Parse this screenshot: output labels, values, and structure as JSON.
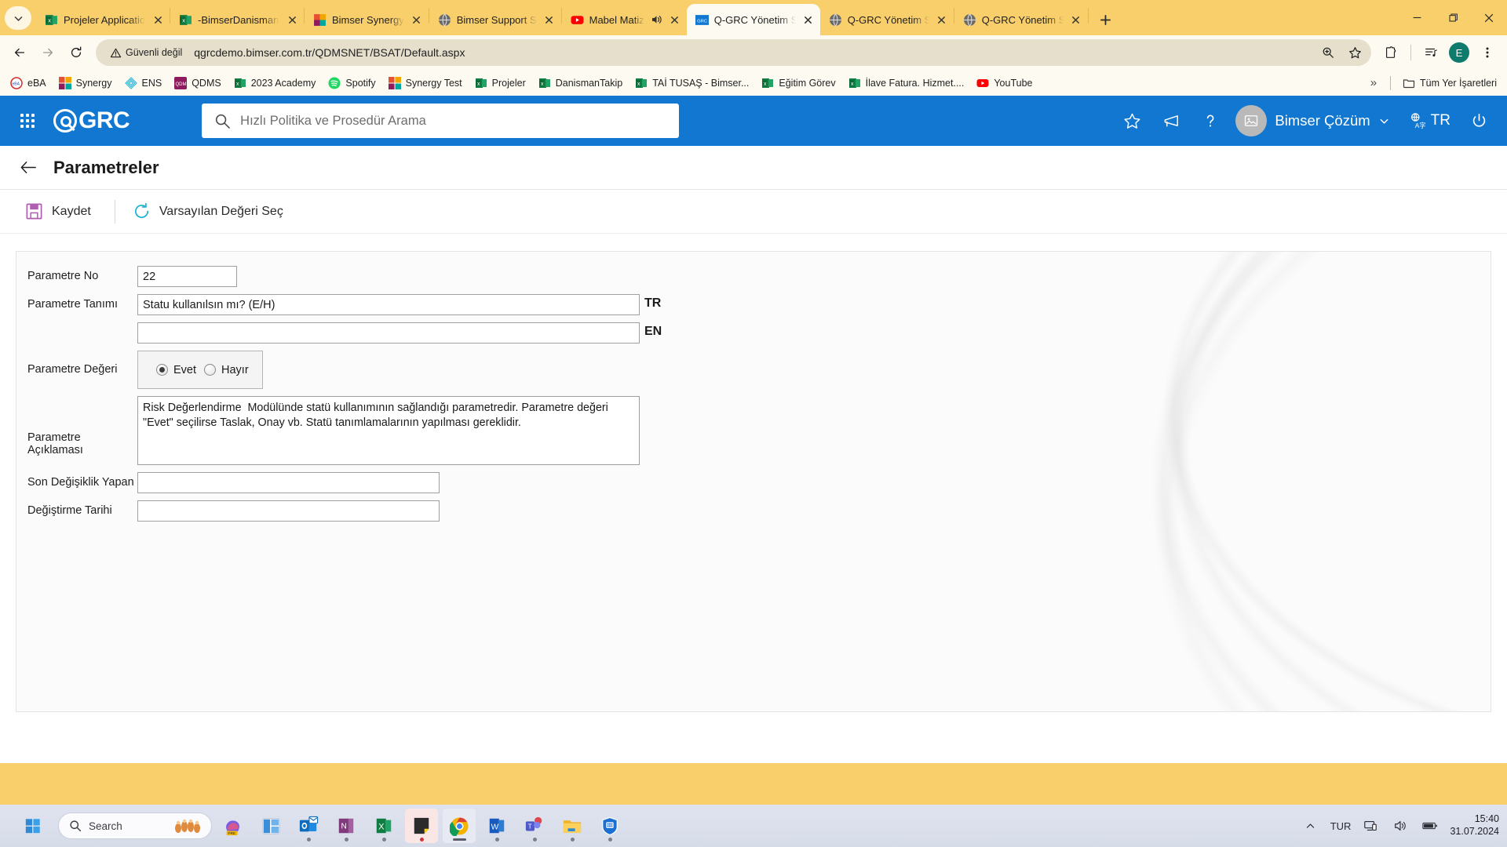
{
  "browser": {
    "tabs": [
      {
        "title": "Projeler Application",
        "favicon": "excel-icon"
      },
      {
        "title": "-BimserDanismanlik",
        "favicon": "excel-icon"
      },
      {
        "title": "Bimser Synergy",
        "favicon": "synergy-icon"
      },
      {
        "title": "Bimser Support S",
        "favicon": "globe-icon"
      },
      {
        "title": "Mabel Matiz",
        "favicon": "youtube-icon",
        "audio": true
      },
      {
        "title": "Q-GRC Yönetim S",
        "favicon": "qgrc-icon",
        "active": true
      },
      {
        "title": "Q-GRC Yönetim S",
        "favicon": "globe-icon"
      },
      {
        "title": "Q-GRC Yönetim S",
        "favicon": "globe-icon"
      }
    ],
    "new_tab_label": "+",
    "security_label": "Güvenli değil",
    "url": "qgrcdemo.bimser.com.tr/QDMSNET/BSAT/Default.aspx",
    "profile_initial": "E",
    "bookmarks": [
      {
        "label": "eBA",
        "icon": "eba-icon"
      },
      {
        "label": "Synergy",
        "icon": "synergy-icon"
      },
      {
        "label": "ENS",
        "icon": "ens-icon"
      },
      {
        "label": "QDMS",
        "icon": "qdms-icon"
      },
      {
        "label": "2023 Academy",
        "icon": "excel-icon"
      },
      {
        "label": "Spotify",
        "icon": "spotify-icon"
      },
      {
        "label": "Synergy Test",
        "icon": "synergy-icon"
      },
      {
        "label": "Projeler",
        "icon": "excel-icon"
      },
      {
        "label": "DanismanTakip",
        "icon": "excel-icon"
      },
      {
        "label": "TAİ TUSAŞ - Bimser...",
        "icon": "excel-icon"
      },
      {
        "label": "Eğitim Görev",
        "icon": "excel-icon"
      },
      {
        "label": "İlave Fatura. Hizmet....",
        "icon": "excel-icon"
      },
      {
        "label": "YouTube",
        "icon": "youtube-icon"
      }
    ],
    "bookmarks_overflow": "»",
    "all_bookmarks_label": "Tüm Yer İşaretleri"
  },
  "app": {
    "brand": "GRC",
    "search_placeholder": "Hızlı Politika ve Prosedür Arama",
    "user_name": "Bimser Çözüm",
    "language": "TR",
    "accent_color": "#1177d1"
  },
  "page": {
    "title": "Parametreler",
    "toolbar": {
      "save_label": "Kaydet",
      "default_value_label": "Varsayılan Değeri Seç"
    },
    "form": {
      "param_no": {
        "label": "Parametre No",
        "value": "22"
      },
      "param_name": {
        "label": "Parametre Tanımı",
        "tr_value": "Statu kullanılsın mı? (E/H)",
        "tr_suffix": "TR",
        "en_value": "",
        "en_suffix": "EN"
      },
      "param_value": {
        "label": "Parametre Değeri",
        "options": [
          {
            "label": "Evet",
            "selected": true
          },
          {
            "label": "Hayır",
            "selected": false
          }
        ]
      },
      "param_desc": {
        "label": "Parametre Açıklaması",
        "value": "Risk Değerlendirme  Modülünde statü kullanımının sağlandığı parametredir. Parametre değeri \"Evet\" seçilirse Taslak, Onay vb. Statü tanımlamalarının yapılması gereklidir."
      },
      "last_modified_by": {
        "label": "Son Değişiklik Yapan",
        "value": ""
      },
      "modified_date": {
        "label": "Değiştirme Tarihi",
        "value": ""
      }
    }
  },
  "taskbar": {
    "search_placeholder": "Search",
    "apps": [
      {
        "name": "copilot"
      },
      {
        "name": "widgets"
      },
      {
        "name": "outlook"
      },
      {
        "name": "onenote"
      },
      {
        "name": "excel"
      },
      {
        "name": "sticky-notes"
      },
      {
        "name": "chrome"
      },
      {
        "name": "word"
      },
      {
        "name": "teams"
      },
      {
        "name": "file-explorer"
      },
      {
        "name": "security"
      }
    ],
    "language": "TUR",
    "time": "15:40",
    "date": "31.07.2024"
  }
}
